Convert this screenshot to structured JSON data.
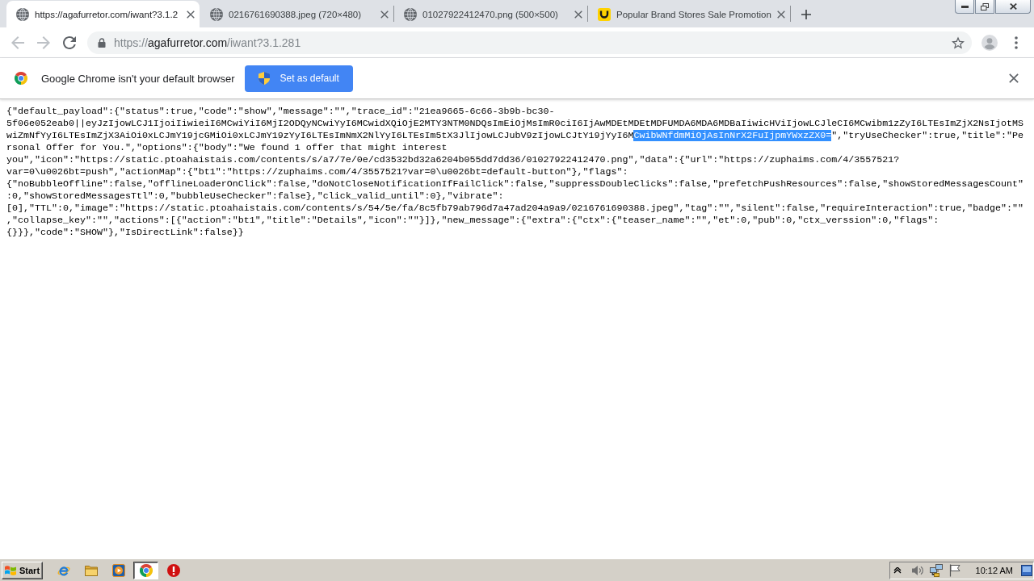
{
  "tabs": [
    {
      "kind": "generic",
      "title": "https://agafurretor.com/iwant?3.1.2",
      "selected": true
    },
    {
      "kind": "generic",
      "title": "0216761690388.jpeg (720×480)",
      "selected": false
    },
    {
      "kind": "generic",
      "title": "01027922412470.png (500×500)",
      "selected": false
    },
    {
      "kind": "site",
      "title": "Popular Brand Stores Sale Promotion",
      "selected": false
    }
  ],
  "toolbar": {
    "back": {
      "disabled": true
    },
    "forward": {
      "disabled": true
    },
    "url": {
      "scheme": "https://",
      "host": "agafurretor.com",
      "path": "/iwant?3.1.281"
    }
  },
  "infobar": {
    "message": "Google Chrome isn't your default browser",
    "button": "Set as default"
  },
  "document": {
    "lines": [
      [
        {
          "text": "{\"default_payload\":{\"status\":true,\"code\":\"show\",\"message\":\"\",\"trace_id\":\"21ea9665-6c66-3b9b-bc30-",
          "selected": false
        }
      ],
      [
        {
          "text": "5f06e052eab0||eyJzIjowLCJ1IjoiIiwieiI6MCwiYiI6MjI2ODQyNCwiYyI6MCwidXQiOjE2MTY3NTM0NDQsImEiOjMsImR0ciI6IjAwMDEtMDEtMDFUMDA6MDA6MDBaIiwicHViIjowLCJleCI6MCwibm1zZyI6LTEsImZjX2NsIjotMS",
          "selected": false
        }
      ],
      [
        {
          "text": "wiZmNfYyI6LTEsImZjX3AiOi0xLCJmY19jcGMiOi0xLCJmY19zYyI6LTEsImNmX2NlYyI6LTEsIm5tX3JlIjowLCJubV9zIjowLCJtY19jYyI6M",
          "selected": false
        },
        {
          "text": "CwibWNfdmMiOjAsInNrX2FuIjpmYWxzZX0=",
          "selected": true
        },
        {
          "text": "\",\"tryUseChecker\":true,\"title\":\"Pe",
          "selected": false
        }
      ],
      [
        {
          "text": "rsonal Offer for You.\",\"options\":{\"body\":\"We found 1 offer that might interest",
          "selected": false
        }
      ],
      [
        {
          "text": "you\",\"icon\":\"https://static.ptoahaistais.com/contents/s/a7/7e/0e/cd3532bd32a6204b055dd7dd36/01027922412470.png\",\"data\":{\"url\":\"https://zuphaims.com/4/3557521?",
          "selected": false
        }
      ],
      [
        {
          "text": "var=0\\u0026bt=push\",\"actionMap\":{\"bt1\":\"https://zuphaims.com/4/3557521?var=0\\u0026bt=default-button\"},\"flags\":",
          "selected": false
        }
      ],
      [
        {
          "text": "{\"noBubbleOffline\":false,\"offlineLoaderOnClick\":false,\"doNotCloseNotificationIfFailClick\":false,\"suppressDoubleClicks\":false,\"prefetchPushResources\":false,\"showStoredMessagesCount\"",
          "selected": false
        }
      ],
      [
        {
          "text": ":0,\"showStoredMessagesTtl\":0,\"bubbleUseChecker\":false},\"click_valid_until\":0},\"vibrate\":",
          "selected": false
        }
      ],
      [
        {
          "text": "[0],\"TTL\":0,\"image\":\"https://static.ptoahaistais.com/contents/s/54/5e/fa/8c5fb79ab796d7a47ad204a9a9/0216761690388.jpeg\",\"tag\":\"\",\"silent\":false,\"requireInteraction\":true,\"badge\":\"\"",
          "selected": false
        }
      ],
      [
        {
          "text": ",\"collapse_key\":\"\",\"actions\":[{\"action\":\"bt1\",\"title\":\"Details\",\"icon\":\"\"}]},\"new_message\":{\"extra\":{\"ctx\":{\"teaser_name\":\"\",\"et\":0,\"pub\":0,\"ctx_verssion\":0,\"flags\":",
          "selected": false
        }
      ],
      [
        {
          "text": "{}}},\"code\":\"SHOW\"},\"IsDirectLink\":false}}",
          "selected": false
        }
      ]
    ]
  },
  "taskbar": {
    "start": "Start",
    "apps": [
      {
        "kind": "explorer",
        "active": false
      },
      {
        "kind": "folder",
        "active": false
      },
      {
        "kind": "player",
        "active": false
      },
      {
        "kind": "chrome",
        "active": true
      },
      {
        "kind": "alert",
        "active": false
      }
    ],
    "clock": "10:12 AM"
  }
}
